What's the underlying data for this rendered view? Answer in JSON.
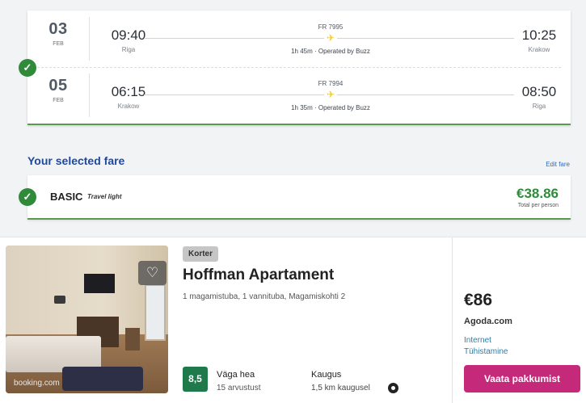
{
  "flights": [
    {
      "day": "03",
      "month": "FEB",
      "dep_time": "09:40",
      "dep_city": "Riga",
      "arr_time": "10:25",
      "arr_city": "Krakow",
      "flight_no": "FR 7995",
      "duration": "1h 45m · Operated by Buzz"
    },
    {
      "day": "05",
      "month": "FEB",
      "dep_time": "06:15",
      "dep_city": "Krakow",
      "arr_time": "08:50",
      "arr_city": "Riga",
      "flight_no": "FR 7994",
      "duration": "1h 35m · Operated by Buzz"
    }
  ],
  "icons": {
    "check": "✓",
    "plane": "✈",
    "heart": "♡"
  },
  "fare": {
    "section_title": "Your selected fare",
    "edit_link": "Edit fare",
    "name": "BASIC",
    "subtitle": "Travel light",
    "price": "€38.86",
    "price_note": "Total per person"
  },
  "hotel": {
    "type_tag": "Korter",
    "name": "Hoffman Apartament",
    "meta": "1 magamistuba, 1 vannituba, Magamiskohti 2",
    "photo_caption": "booking.com",
    "rating_score": "8,5",
    "rating_label": "Väga hea",
    "rating_count": "15 arvustust",
    "distance_label": "Kaugus",
    "distance_value": "1,5 km kaugusel",
    "price": "€86",
    "provider": "Agoda.com",
    "feature1": "Internet",
    "feature2": "Tühistamine",
    "cta": "Vaata pakkumist"
  },
  "colors": {
    "accent_green": "#2f8a3a",
    "fare_title_blue": "#1d4aa0",
    "cta_pink": "#c4297a",
    "rating_green": "#1f7a4b",
    "plane_yellow": "#f1c933"
  }
}
